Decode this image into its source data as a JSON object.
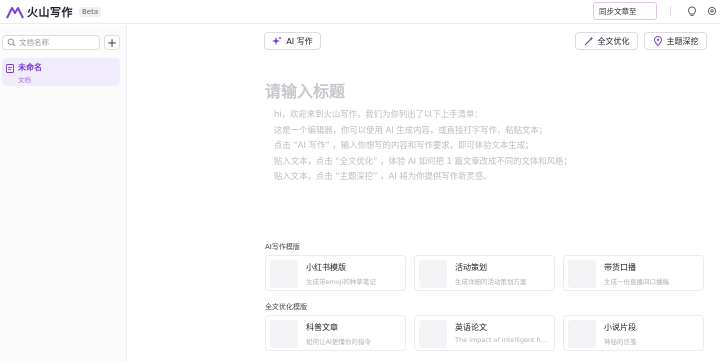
{
  "header": {
    "logo_text": "火山写作",
    "beta_badge": "Beta",
    "sync_button": "同步文章至",
    "icons": [
      "lightbulb-icon",
      "settings-icon"
    ]
  },
  "sidebar": {
    "search_placeholder": "文档名称",
    "add_icon": "plus-icon",
    "documents": [
      {
        "title": "未命名",
        "subtitle": "文档"
      }
    ]
  },
  "toolbar": {
    "ai_write": "AI 写作",
    "full_optimize": "全文优化",
    "topic_dig": "主题深挖"
  },
  "editor": {
    "title_placeholder": "请输入标题",
    "intro_lines": [
      "hi，欢迎来到火山写作，我们为你列出了以下上手清单：",
      "这是一个编辑器，你可以使用 AI 生成内容，或直接打字写作，粘贴文本；",
      "点击 “AI 写作” ，输入你想写的内容和写作要求，即可体验文本生成；",
      "贴入文本，点击 “全文优化” ，体验 AI 如何把 1 篇文章改成不同的文体和风格；",
      "贴入文本，点击 “主题深挖” ，AI 将为你提供写作新灵感。"
    ]
  },
  "templates": {
    "ai_section_label": "AI写作模版",
    "ai_cards": [
      {
        "title": "小红书模版",
        "desc": "生成带emoji的种草笔记"
      },
      {
        "title": "活动策划",
        "desc": "生成详细的活动策划方案"
      },
      {
        "title": "带货口播",
        "desc": "生成一份直播间口播稿"
      }
    ],
    "opt_section_label": "全文优化模版",
    "opt_cards": [
      {
        "title": "科普文章",
        "desc": "如何让AI更懂你的指令"
      },
      {
        "title": "英语论文",
        "desc": "The impact of intelligent hou..."
      },
      {
        "title": "小说片段",
        "desc": "神秘的信笺"
      }
    ]
  },
  "colors": {
    "accent": "#7a3fd0",
    "selected_bg": "#f1ecfb",
    "sync_border": "#e6c2f0"
  }
}
